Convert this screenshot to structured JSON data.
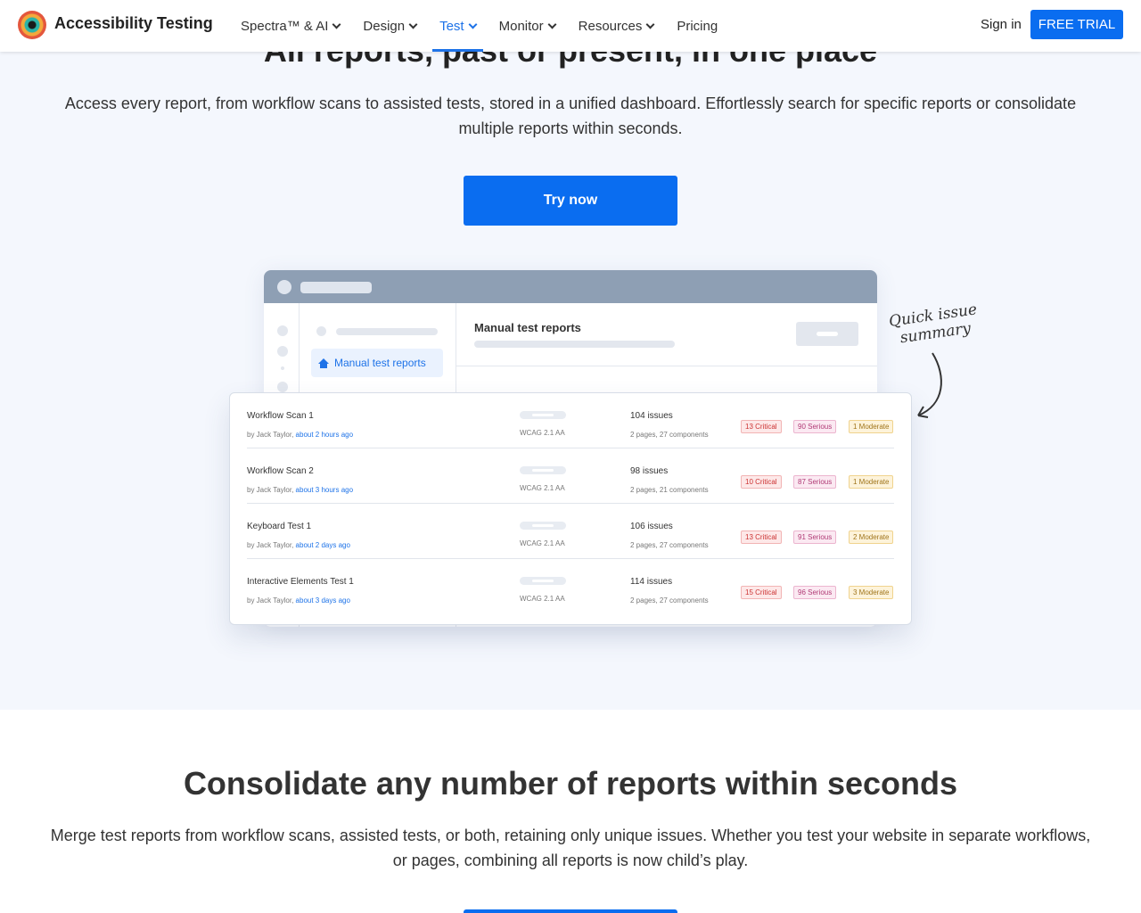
{
  "header": {
    "brand": "Accessibility Testing",
    "menu": [
      {
        "label": "Spectra™ & AI",
        "active": false
      },
      {
        "label": "Design",
        "active": false
      },
      {
        "label": "Test",
        "active": true
      },
      {
        "label": "Monitor",
        "active": false
      },
      {
        "label": "Resources",
        "active": false
      },
      {
        "label": "Pricing",
        "active": false
      }
    ],
    "signin": "Sign in",
    "trial": "FREE TRIAL"
  },
  "hero": {
    "title": "All reports, past or present, in one place",
    "description": "Access every report, from workflow scans to assisted tests, stored in a unified dashboard. Effortlessly search for specific reports or consolidate multiple reports within seconds.",
    "cta": "Try now"
  },
  "illustration": {
    "sidebar_item": "Manual test reports",
    "main_title": "Manual test reports",
    "annotation": "Quick issue summary",
    "reports": [
      {
        "name": "Workflow Scan 1",
        "by": "by Jack Taylor, ",
        "time": "about 2 hours ago",
        "standard": "WCAG 2.1 AA",
        "issues": "104 issues",
        "pages": "2 pages, 27 components",
        "critical": "13 Critical",
        "serious": "90 Serious",
        "moderate": "1 Moderate"
      },
      {
        "name": "Workflow Scan 2",
        "by": "by Jack Taylor, ",
        "time": "about 3 hours ago",
        "standard": "WCAG 2.1 AA",
        "issues": "98 issues",
        "pages": "2 pages, 21 components",
        "critical": "10 Critical",
        "serious": "87 Serious",
        "moderate": "1 Moderate"
      },
      {
        "name": "Keyboard Test 1",
        "by": "by Jack Taylor, ",
        "time": "about 2 days ago",
        "standard": "WCAG 2.1 AA",
        "issues": "106 issues",
        "pages": "2 pages, 27 components",
        "critical": "13 Critical",
        "serious": "91 Serious",
        "moderate": "2 Moderate"
      },
      {
        "name": "Interactive Elements Test 1",
        "by": "by Jack Taylor, ",
        "time": "about 3 days ago",
        "standard": "WCAG 2.1 AA",
        "issues": "114 issues",
        "pages": "2 pages, 27 components",
        "critical": "15 Critical",
        "serious": "96 Serious",
        "moderate": "3 Moderate"
      }
    ]
  },
  "section2": {
    "title": "Consolidate any number of reports within seconds",
    "description": "Merge test reports from workflow scans, assisted tests, or both, retaining only unique issues. Whether you test your website in separate workflows, or pages, combining all reports is now child’s play."
  },
  "colors": {
    "primary": "#0a6df0",
    "hero_bg": "#f4f7fd"
  }
}
